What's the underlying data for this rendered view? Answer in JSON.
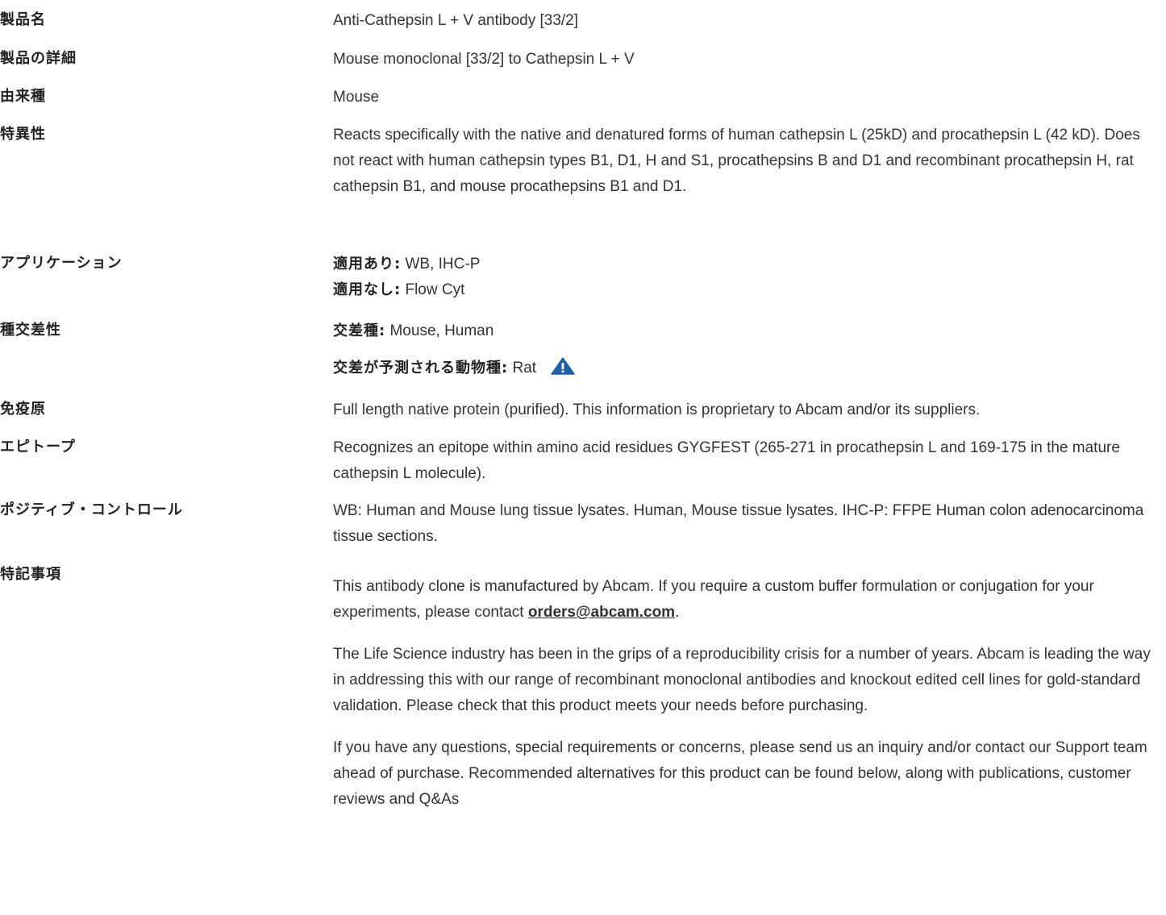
{
  "rows": {
    "product_name": {
      "label": "製品名",
      "value": "Anti-Cathepsin L + V antibody [33/2]"
    },
    "product_detail": {
      "label": "製品の詳細",
      "value": "Mouse monoclonal [33/2] to Cathepsin L + V"
    },
    "host": {
      "label": "由来種",
      "value": "Mouse"
    },
    "specificity": {
      "label": "特異性",
      "value": "Reacts specifically with the native and denatured forms of human cathepsin L (25kD) and procathepsin L (42 kD). Does not react with human cathepsin types B1, D1, H and S1, procathepsins B and D1 and recombinant procathepsin H, rat cathepsin B1, and mouse procathepsins B1 and D1."
    },
    "application": {
      "label": "アプリケーション",
      "suited_label": "適用あり:",
      "suited_value": " WB, IHC-P",
      "unsuited_label": "適用なし:",
      "unsuited_value": " Flow Cyt"
    },
    "reactivity": {
      "label": "種交差性",
      "reacts_label": "交差種:",
      "reacts_value": " Mouse, Human",
      "predicted_label": "交差が予測される動物種:",
      "predicted_value": " Rat",
      "icon": "warning-triangle-icon",
      "icon_color": "#1f5fa8"
    },
    "immunogen": {
      "label": "免疫原",
      "value": "Full length native protein (purified). This information is proprietary to Abcam and/or its suppliers."
    },
    "epitope": {
      "label": "エピトープ",
      "value": "Recognizes an epitope within amino acid residues GYGFEST (265-271 in procathepsin L and 169-175 in the mature cathepsin L molecule)."
    },
    "positive_control": {
      "label": "ポジティブ・コントロール",
      "value": "WB: Human and Mouse lung tissue lysates. Human, Mouse tissue lysates. IHC-P: FFPE Human colon adenocarcinoma tissue sections."
    },
    "notes": {
      "label": "特記事項",
      "p1_before": "This antibody clone is manufactured by Abcam. If you require a custom buffer formulation or conjugation for your experiments, please contact ",
      "p1_link": "orders@abcam.com",
      "p1_after": ".",
      "p2": "The Life Science industry has been in the grips of a reproducibility crisis for a number of years. Abcam is leading the way in addressing this with our range of recombinant monoclonal antibodies and knockout edited cell lines for gold-standard validation. Please check that this product meets your needs before purchasing.",
      "p3": "If you have any questions, special requirements or concerns, please send us an inquiry and/or contact our Support team ahead of purchase. Recommended alternatives for this product can be found below, along with publications, customer reviews and Q&As"
    }
  }
}
